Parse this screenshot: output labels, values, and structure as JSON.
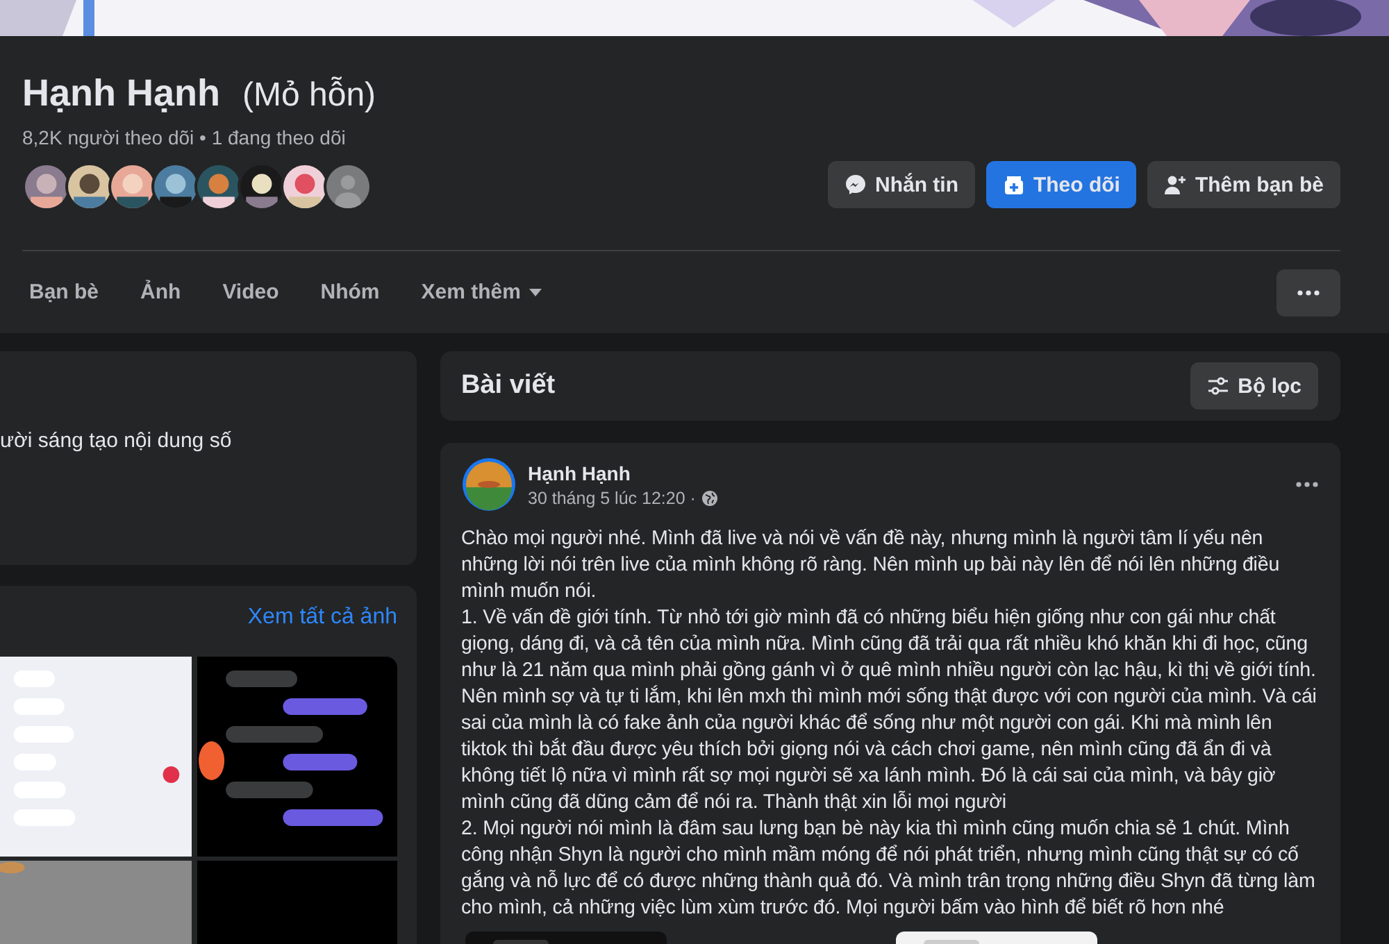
{
  "cover": {
    "kind": "picture"
  },
  "profile": {
    "name": "Hạnh Hạnh",
    "nickname": "(Mỏ hỗn)",
    "stats": "8,2K người theo dõi • 1 đang theo dõi",
    "friend_avatars": [
      {
        "kind": "picture"
      },
      {
        "kind": "picture"
      },
      {
        "kind": "picture"
      },
      {
        "kind": "picture"
      },
      {
        "kind": "picture"
      },
      {
        "kind": "picture"
      },
      {
        "kind": "picture"
      },
      {
        "kind": "placeholder"
      }
    ],
    "actions": [
      {
        "label": "Nhắn tin",
        "kind": "message",
        "primary": false
      },
      {
        "label": "Theo dõi",
        "kind": "follow",
        "primary": true
      },
      {
        "label": "Thêm bạn bè",
        "kind": "add-friend",
        "primary": false
      }
    ]
  },
  "tabs": [
    {
      "label": "Bạn bè",
      "selected": false
    },
    {
      "label": "Ảnh",
      "selected": false
    },
    {
      "label": "Video",
      "selected": false
    },
    {
      "label": "Nhóm",
      "selected": false
    },
    {
      "label": "Xem thêm",
      "selected": false,
      "dropdown": true
    }
  ],
  "intro": {
    "text": "ười sáng tạo nội dung số"
  },
  "photos": {
    "link": "Xem tất cả ảnh",
    "items": [
      {
        "kind": "picture"
      },
      {
        "kind": "picture"
      },
      {
        "kind": "picture"
      },
      {
        "kind": "picture"
      }
    ]
  },
  "posts_header": {
    "title": "Bài viết",
    "filter": "Bộ lọc"
  },
  "post": {
    "author": "Hạnh Hạnh",
    "time": "30 tháng 5 lúc 12:20 ·",
    "paragraphs": [
      "Chào mọi người nhé. Mình đã live và nói về vấn đề này, nhưng mình là người tâm lí yếu nên những lời nói trên live của mình không rõ ràng. Nên mình up bài này lên để nói lên những điều mình muốn nói.",
      "1. Về vấn đề giới tính. Từ nhỏ tới giờ mình đã có những biểu hiện giống như con gái như chất giọng, dáng đi, và cả tên của mình nữa. Mình cũng đã trải qua rất nhiều khó khăn khi đi học, cũng như là 21 năm qua mình phải gồng gánh vì ở quê mình nhiều người còn lạc hậu, kì thị về giới tính. Nên mình sợ và tự ti lắm, khi lên mxh thì mình mới sống thật được với con người của mình. Và cái sai của mình là có fake ảnh của người khác để sống như một người con gái. Khi mà mình lên tiktok thì bắt đầu được yêu thích bởi giọng nói và cách chơi game, nên mình cũng đã ẩn đi và không tiết lộ nữa vì mình rất sợ mọi người sẽ xa lánh mình. Đó là cái sai của mình, và bây giờ mình cũng đã dũng cảm để nói ra. Thành thật xin lỗi mọi người",
      "2. Mọi người nói mình là đâm sau lưng bạn bè này kia thì mình cũng muốn chia sẻ 1 chút. Mình công nhận Shyn là người cho mình mầm móng để nói phát triển, nhưng mình cũng thật sự có cố gắng và nỗ lực để có được những thành quả đó. Và mình trân trọng những điều Shyn đã từng làm cho mình, cả những việc lùm xùm trước đó. Mọi người bấm vào hình để biết rõ hơn nhé"
    ],
    "images": [
      {
        "kind": "picture"
      },
      {
        "kind": "picture"
      }
    ]
  }
}
